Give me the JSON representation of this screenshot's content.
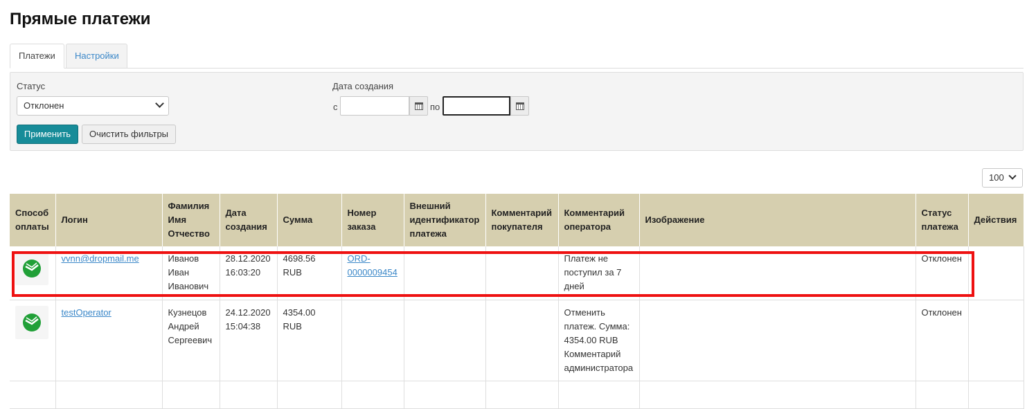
{
  "page_title": "Прямые платежи",
  "tabs": [
    {
      "label": "Платежи",
      "active": true
    },
    {
      "label": "Настройки",
      "active": false
    }
  ],
  "filters": {
    "status_label": "Статус",
    "status_value": "Отклонен",
    "date_label": "Дата создания",
    "from_label": "с",
    "to_label": "по",
    "from_value": "",
    "to_value": "",
    "apply_button": "Применить",
    "clear_button": "Очистить фильтры"
  },
  "per_page": "100",
  "table": {
    "headers": [
      "Способ оплаты",
      "Логин",
      "Фамилия Имя Отчество",
      "Дата создания",
      "Сумма",
      "Номер заказа",
      "Внешний идентификатор платежа",
      "Комментарий покупателя",
      "Комментарий оператора",
      "Изображение",
      "Статус платежа",
      "Действия"
    ],
    "rows": [
      {
        "payment_icon": "sberbank-logo-icon",
        "login": "vvnn@dropmail.me",
        "name_lines": [
          "Иванов",
          "Иван",
          "Иванович"
        ],
        "date_lines": [
          "28.12.2020",
          "16:03:20"
        ],
        "sum_lines": [
          "4698.56",
          "RUB"
        ],
        "order_lines": [
          "ORD-",
          "0000009454"
        ],
        "external_id": "",
        "buyer_comment": "",
        "operator_comment_lines": [
          "Платеж не",
          "поступил за 7",
          "дней"
        ],
        "image": "",
        "status": "Отклонен",
        "actions": ""
      },
      {
        "payment_icon": "sberbank-logo-icon",
        "login": "testOperator",
        "name_lines": [
          "Кузнецов",
          "Андрей",
          "Сергеевич"
        ],
        "date_lines": [
          "24.12.2020",
          "15:04:38"
        ],
        "sum_lines": [
          "4354.00",
          "RUB"
        ],
        "order_lines": [],
        "external_id": "",
        "buyer_comment": "",
        "operator_comment_lines": [
          "Отменить",
          "платеж. Сумма:",
          "4354.00 RUB",
          "Комментарий",
          "администратора"
        ],
        "image": "",
        "status": "Отклонен",
        "actions": ""
      }
    ]
  },
  "colors": {
    "header_bg": "#d6cfaf",
    "primary_button": "#178c99",
    "link": "#3a87c8",
    "highlight": "#ee1111",
    "sber_green": "#21a038"
  }
}
